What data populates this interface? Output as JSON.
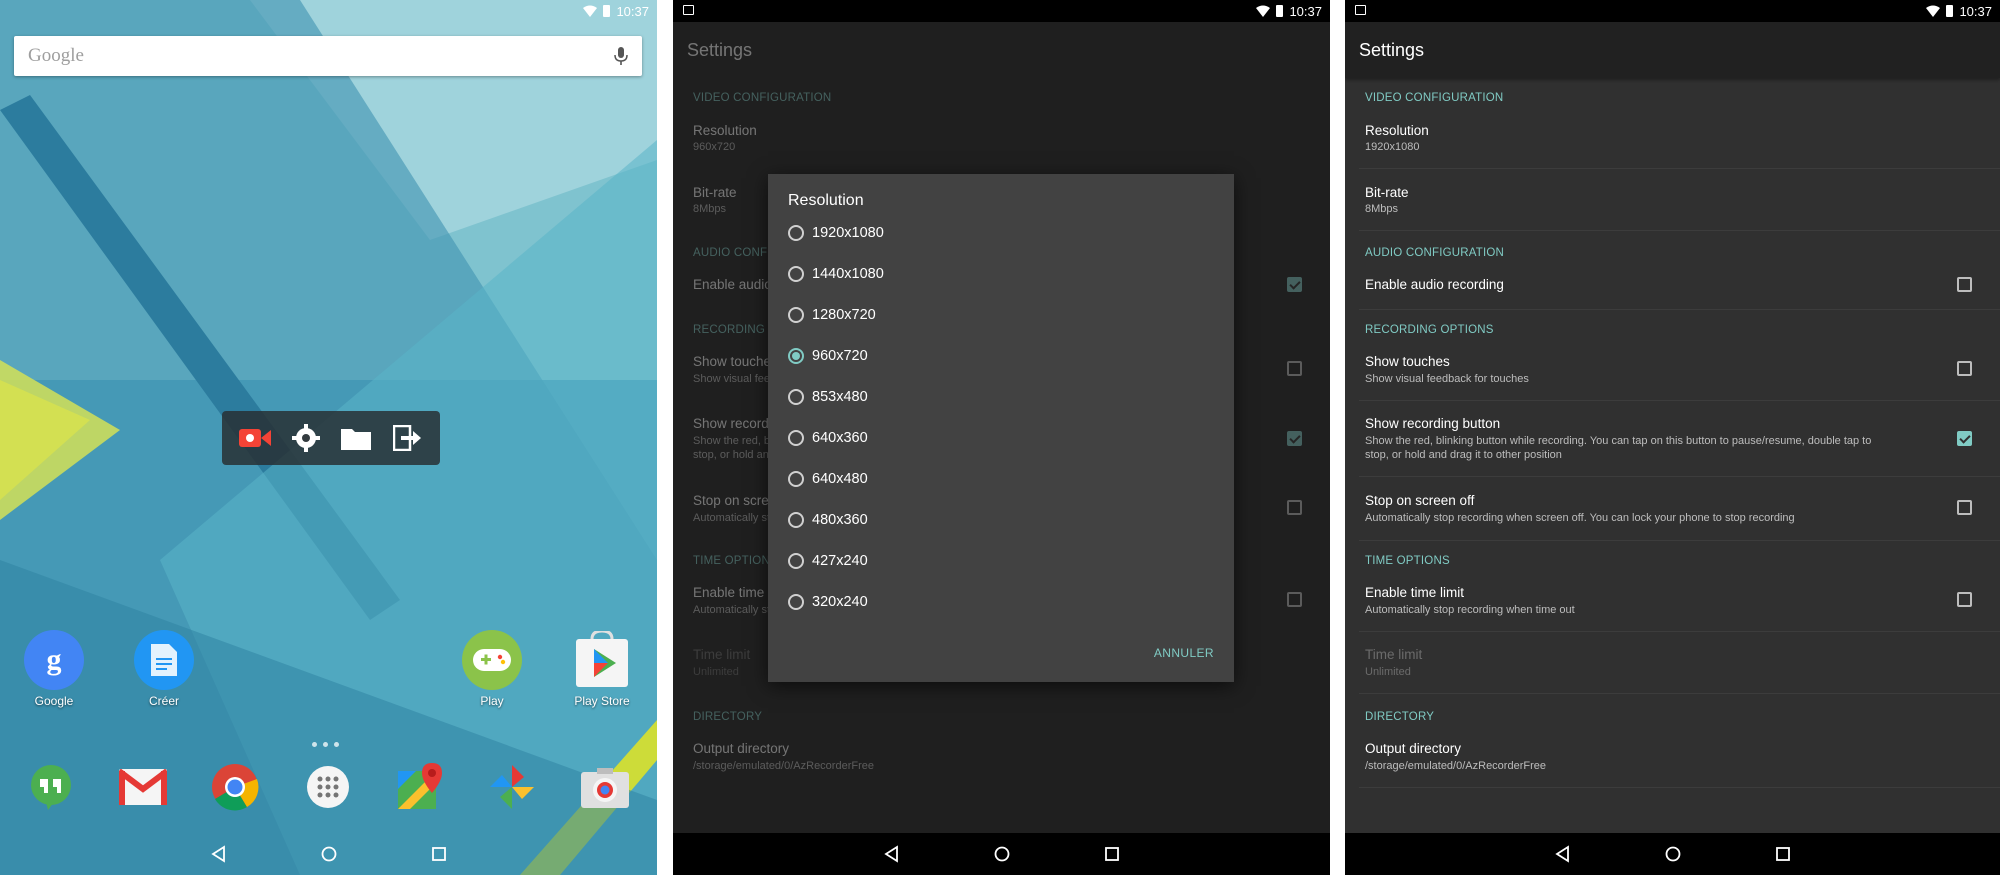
{
  "status": {
    "time": "10:37"
  },
  "home": {
    "search_placeholder": "Google",
    "apps": [
      {
        "label": "Google"
      },
      {
        "label": "Créer"
      },
      {
        "label": "Play"
      },
      {
        "label": "Play Store"
      }
    ],
    "recorder_overlay": [
      "record-icon",
      "settings-icon",
      "folder-icon",
      "exit-icon"
    ],
    "dock": [
      "hangouts-icon",
      "gmail-icon",
      "chrome-icon",
      "app-drawer-icon",
      "maps-icon",
      "photos-icon",
      "camera-icon"
    ]
  },
  "settings": {
    "title": "Settings",
    "cat_video": "VIDEO CONFIGURATION",
    "resolution_title": "Resolution",
    "resolution_value_screen2": "960x720",
    "resolution_value_screen3": "1920x1080",
    "bitrate_title": "Bit-rate",
    "bitrate_value": "8Mbps",
    "cat_audio": "AUDIO CONFIGURATION",
    "audio_title": "Enable audio recording",
    "cat_recording": "RECORDING OPTIONS",
    "touches_title": "Show touches",
    "touches_summary": "Show visual feedback for touches",
    "rec_button_title": "Show recording button",
    "rec_button_summary_1": "Show the red, blinking button while recording. You can tap on this button to pause/resume, double tap to",
    "rec_button_summary_2": "stop, or hold and drag it to other position",
    "screenoff_title": "Stop on screen off",
    "screenoff_summary": "Automatically stop recording when screen off. You can lock your phone to stop recording",
    "cat_time": "TIME OPTIONS",
    "timelimit_enable_title": "Enable time limit",
    "timelimit_enable_summary": "Automatically stop recording when time out",
    "timelimit_title": "Time limit",
    "timelimit_value": "Unlimited",
    "cat_directory": "DIRECTORY",
    "output_title": "Output directory",
    "output_value": "/storage/emulated/0/AzRecorderFree",
    "checks_screen2": {
      "audio": true,
      "touches": false,
      "rec_button": true,
      "screenoff": false,
      "timelimit": false
    },
    "checks_screen3": {
      "audio": false,
      "touches": false,
      "rec_button": true,
      "screenoff": false,
      "timelimit": false
    }
  },
  "dialog": {
    "title": "Resolution",
    "options": [
      "1920x1080",
      "1440x1080",
      "1280x720",
      "960x720",
      "853x480",
      "640x360",
      "640x480",
      "480x360",
      "427x240",
      "320x240"
    ],
    "selected": "960x720",
    "cancel": "ANNULER"
  },
  "colors": {
    "accent": "#80cbc4",
    "record_red": "#f44336"
  }
}
